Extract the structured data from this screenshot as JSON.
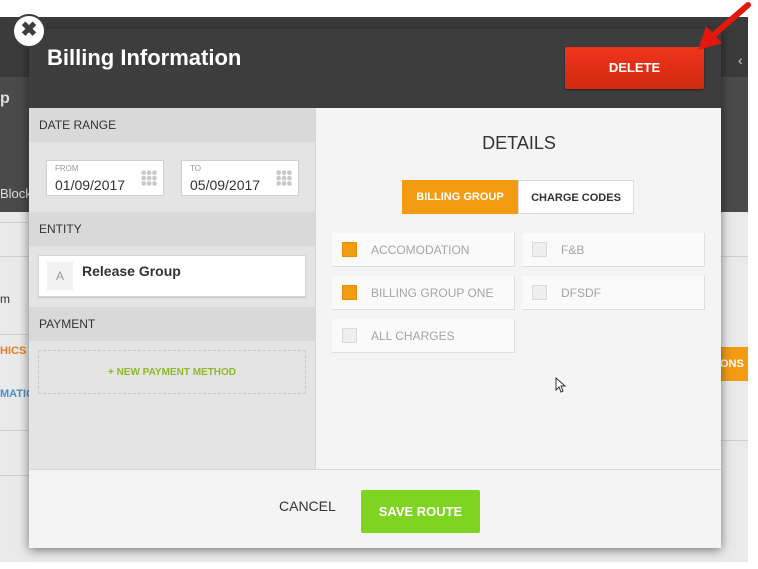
{
  "dialog": {
    "title": "Billing Information",
    "delete_label": "DELETE",
    "close_glyph": "✖"
  },
  "date_range": {
    "header": "DATE RANGE",
    "from_label": "FROM",
    "from_value": "01/09/2017",
    "to_label": "TO",
    "to_value": "05/09/2017"
  },
  "entity": {
    "header": "ENTITY",
    "letter": "A",
    "name": "Release Group"
  },
  "payment": {
    "header": "PAYMENT",
    "new_method_label": "+ NEW PAYMENT METHOD"
  },
  "details": {
    "title": "DETAILS",
    "tabs": [
      {
        "label": "BILLING GROUP",
        "active": true
      },
      {
        "label": "CHARGE CODES",
        "active": false
      }
    ],
    "options": [
      {
        "label": "ACCOMODATION",
        "checked": true
      },
      {
        "label": "F&B",
        "checked": false
      },
      {
        "label": "BILLING GROUP ONE",
        "checked": true
      },
      {
        "label": "DFSDF",
        "checked": false
      },
      {
        "label": "ALL CHARGES",
        "checked": false
      }
    ]
  },
  "footer": {
    "cancel_label": "CANCEL",
    "save_label": "SAVE ROUTE"
  },
  "background": {
    "p_glyph": "p",
    "block_text": "Block",
    "m_text": "m",
    "hics_text": "HICS",
    "matio_text": "MATIO",
    "ons_text": "ONS",
    "chevron": "‹"
  },
  "colors": {
    "accent_orange": "#f39c12",
    "delete_red": "#e0301a",
    "save_green": "#7fd321",
    "header_dark": "#3d3d3d"
  }
}
